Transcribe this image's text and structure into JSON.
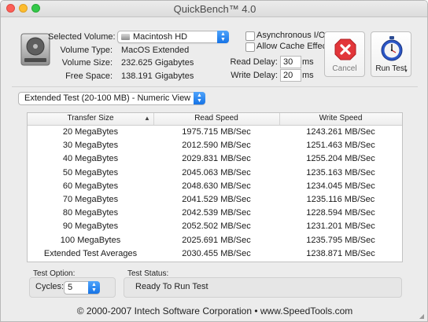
{
  "window": {
    "title": "QuickBench™ 4.0"
  },
  "volume_info": {
    "selected_volume_label": "Selected Volume:",
    "selected_volume_value": "Macintosh HD",
    "volume_type_label": "Volume Type:",
    "volume_type_value": "MacOS Extended",
    "volume_size_label": "Volume Size:",
    "volume_size_value": "232.625 Gigabytes",
    "free_space_label": "Free Space:",
    "free_space_value": "138.191 Gigabytes"
  },
  "options": {
    "async_io_label": "Asynchronous I/O",
    "async_io_checked": false,
    "cache_effects_label": "Allow Cache Effects",
    "cache_effects_checked": false,
    "read_delay_label": "Read Delay:",
    "read_delay_value": "30",
    "read_delay_unit": "ms",
    "write_delay_label": "Write Delay:",
    "write_delay_value": "20",
    "write_delay_unit": "ms"
  },
  "buttons": {
    "cancel_label": "Cancel",
    "run_test_label": "Run Test"
  },
  "view_select": {
    "value": "Extended Test (20-100 MB) - Numeric View"
  },
  "table": {
    "headers": [
      "Transfer Size",
      "Read Speed",
      "Write Speed"
    ],
    "rows": [
      [
        "20 MegaBytes",
        "1975.715 MB/Sec",
        "1243.261 MB/Sec"
      ],
      [
        "30 MegaBytes",
        "2012.590 MB/Sec",
        "1251.463 MB/Sec"
      ],
      [
        "40 MegaBytes",
        "2029.831 MB/Sec",
        "1255.204 MB/Sec"
      ],
      [
        "50 MegaBytes",
        "2045.063 MB/Sec",
        "1235.163 MB/Sec"
      ],
      [
        "60 MegaBytes",
        "2048.630 MB/Sec",
        "1234.045 MB/Sec"
      ],
      [
        "70 MegaBytes",
        "2041.529 MB/Sec",
        "1235.116 MB/Sec"
      ],
      [
        "80 MegaBytes",
        "2042.539 MB/Sec",
        "1228.594 MB/Sec"
      ],
      [
        "90 MegaBytes",
        "2052.502 MB/Sec",
        "1231.201 MB/Sec"
      ],
      [
        "100 MegaBytes",
        "2025.691 MB/Sec",
        "1235.795 MB/Sec"
      ],
      [
        "Extended Test Averages",
        "2030.455 MB/Sec",
        "1238.871 MB/Sec"
      ]
    ]
  },
  "test_option": {
    "group_label": "Test Option:",
    "cycles_label": "Cycles:",
    "cycles_value": "5"
  },
  "test_status": {
    "group_label": "Test Status:",
    "value": "Ready To Run Test"
  },
  "footer": {
    "text": "© 2000-2007 Intech Software Corporation • www.SpeedTools.com"
  },
  "icons": {
    "hard_drive": "hard-drive-icon",
    "cancel": "cancel-x-icon",
    "run_test": "stopwatch-icon"
  },
  "colors": {
    "accent_blue": "#1673e6",
    "cancel_red": "#e2363a",
    "window_bg": "#ececec"
  }
}
